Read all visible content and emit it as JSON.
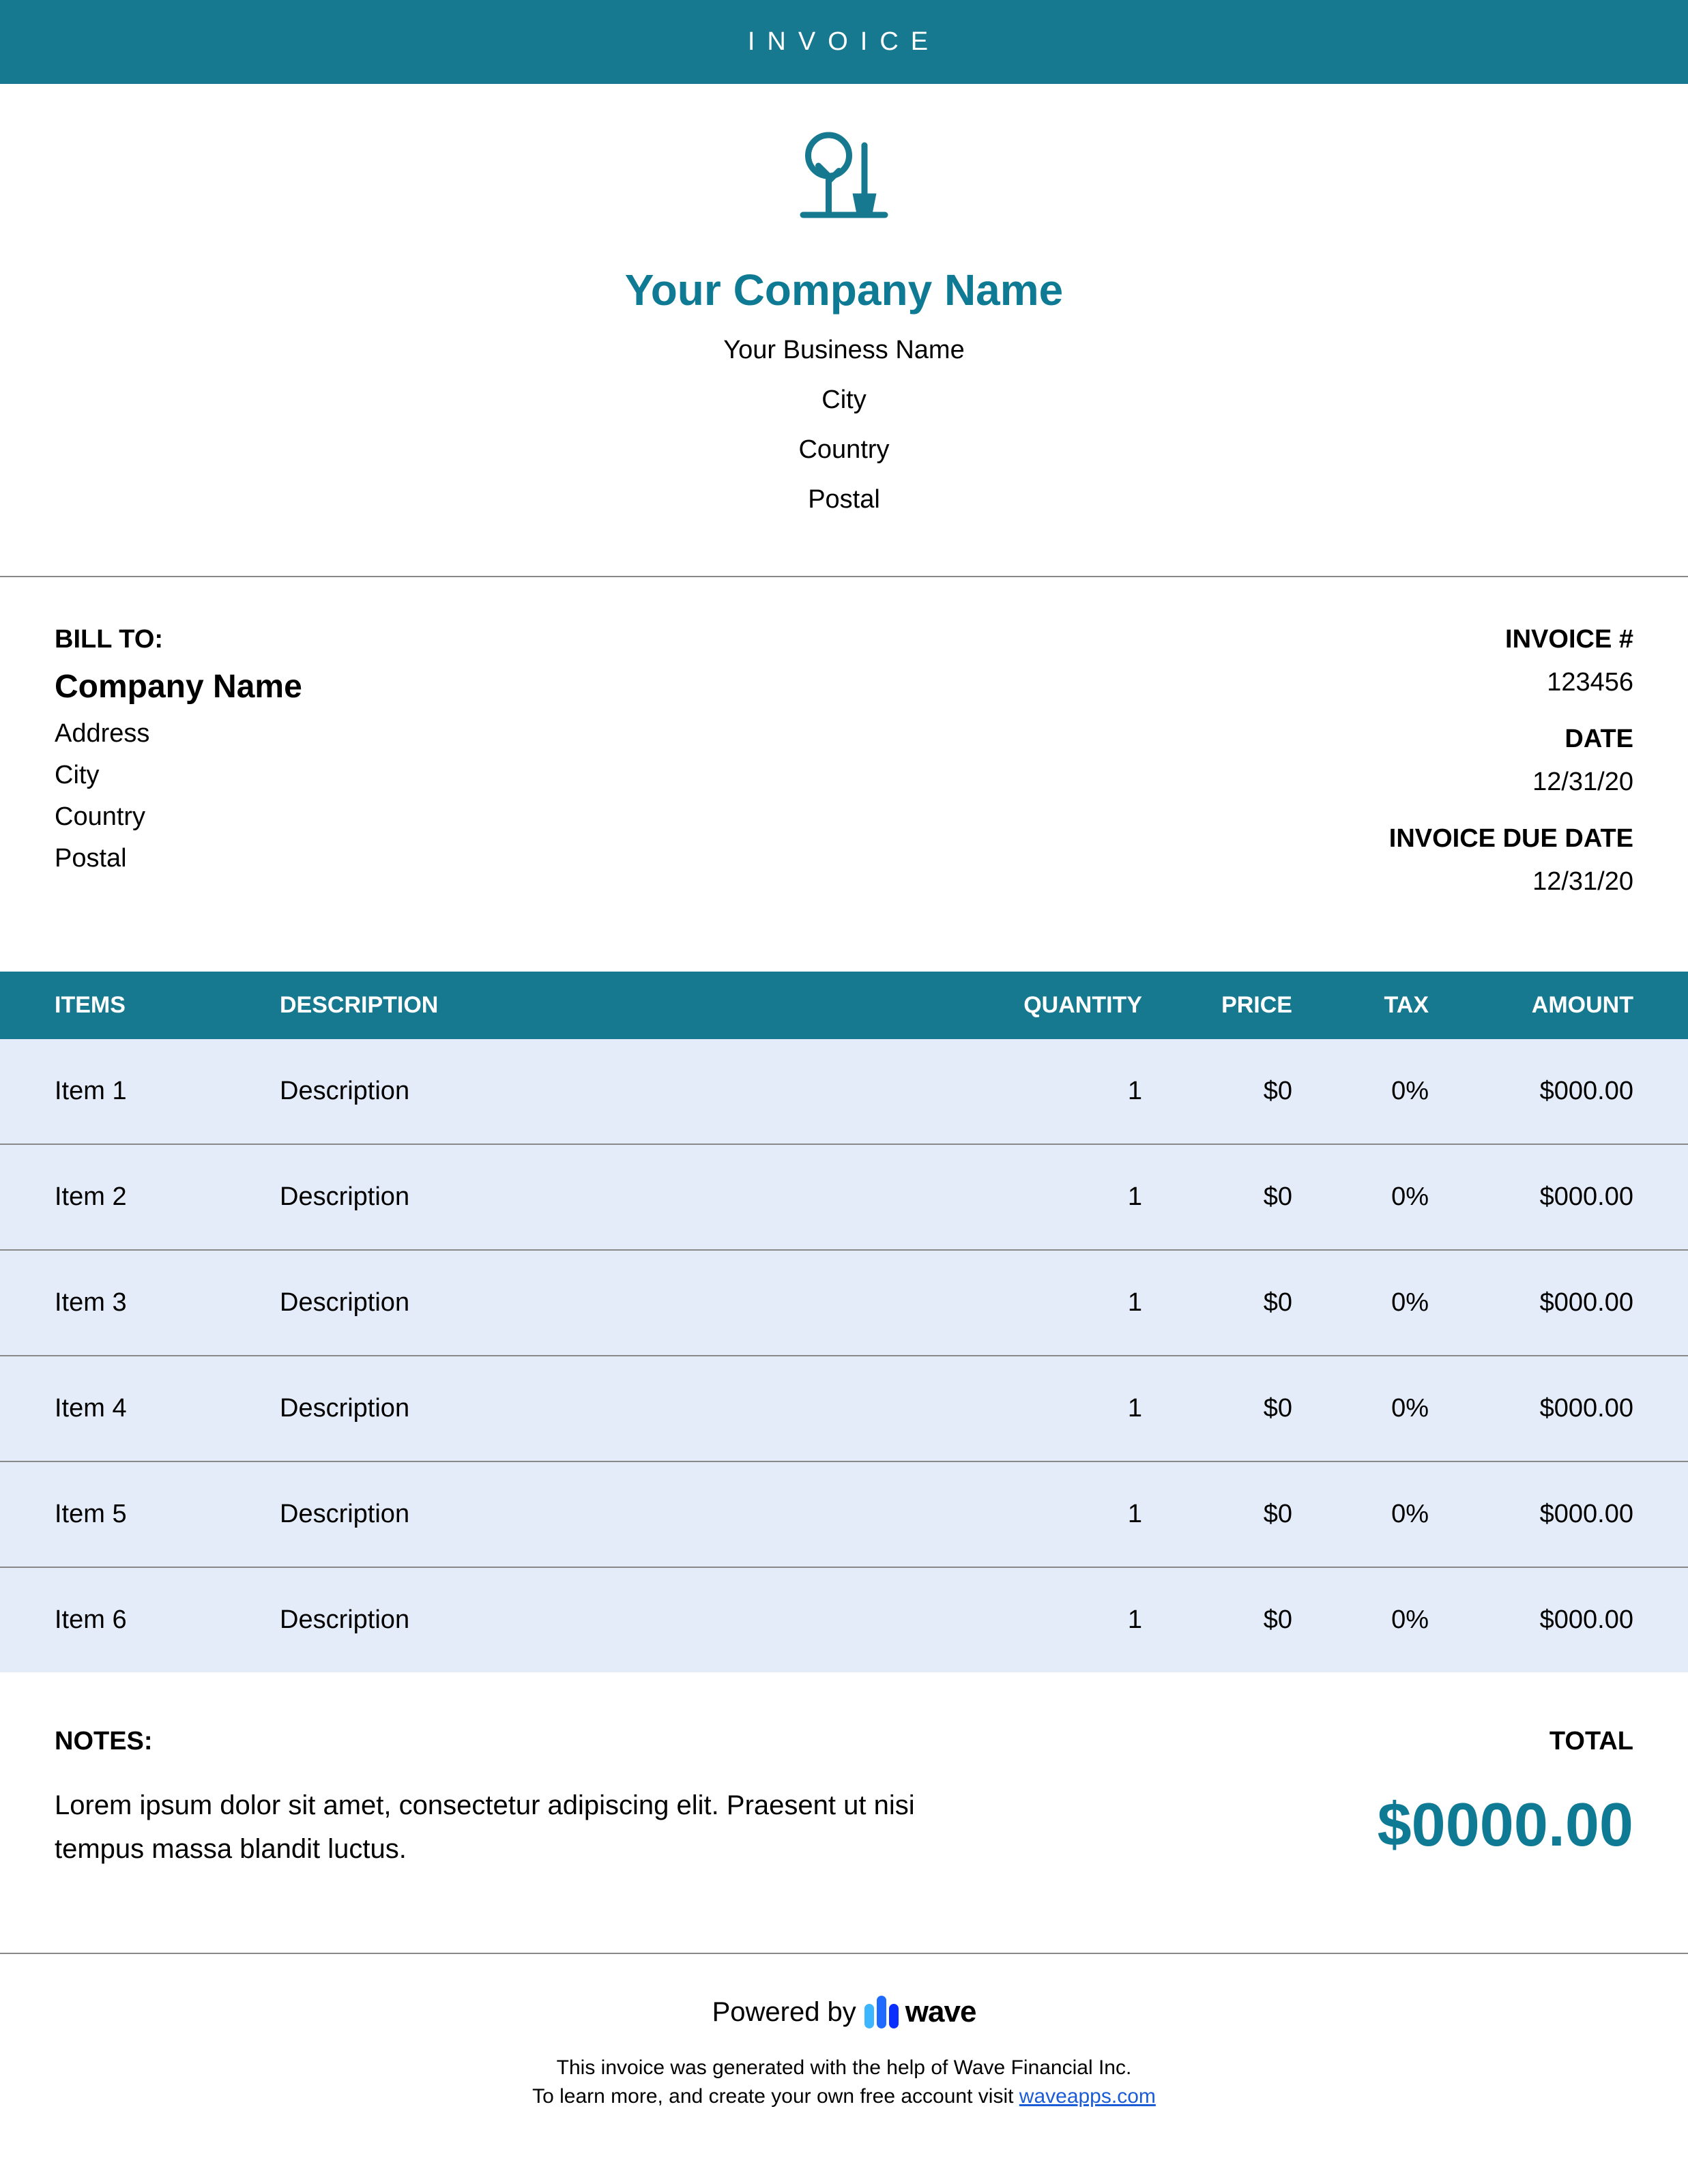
{
  "banner": "INVOICE",
  "company": {
    "name": "Your Company Name",
    "business": "Your Business Name",
    "city": "City",
    "country": "Country",
    "postal": "Postal"
  },
  "bill_to": {
    "label": "BILL TO:",
    "company": "Company Name",
    "address": "Address",
    "city": "City",
    "country": "Country",
    "postal": "Postal"
  },
  "meta": {
    "invoice_num_label": "INVOICE #",
    "invoice_num": "123456",
    "date_label": "DATE",
    "date": "12/31/20",
    "due_label": "INVOICE DUE DATE",
    "due": "12/31/20"
  },
  "columns": {
    "items": "ITEMS",
    "description": "DESCRIPTION",
    "quantity": "QUANTITY",
    "price": "PRICE",
    "tax": "TAX",
    "amount": "AMOUNT"
  },
  "rows": [
    {
      "item": "Item 1",
      "desc": "Description",
      "qty": "1",
      "price": "$0",
      "tax": "0%",
      "amount": "$000.00"
    },
    {
      "item": "Item 2",
      "desc": "Description",
      "qty": "1",
      "price": "$0",
      "tax": "0%",
      "amount": "$000.00"
    },
    {
      "item": "Item 3",
      "desc": "Description",
      "qty": "1",
      "price": "$0",
      "tax": "0%",
      "amount": "$000.00"
    },
    {
      "item": "Item 4",
      "desc": "Description",
      "qty": "1",
      "price": "$0",
      "tax": "0%",
      "amount": "$000.00"
    },
    {
      "item": "Item 5",
      "desc": "Description",
      "qty": "1",
      "price": "$0",
      "tax": "0%",
      "amount": "$000.00"
    },
    {
      "item": "Item 6",
      "desc": "Description",
      "qty": "1",
      "price": "$0",
      "tax": "0%",
      "amount": "$000.00"
    }
  ],
  "notes": {
    "label": "NOTES:",
    "text": "Lorem ipsum dolor sit amet, consectetur adipiscing elit. Praesent ut nisi tempus massa blandit luctus."
  },
  "total": {
    "label": "TOTAL",
    "amount": "$0000.00"
  },
  "footer": {
    "powered_by": "Powered by",
    "brand": "wave",
    "line1": "This invoice was generated with the help of Wave Financial Inc.",
    "line2_pre": "To learn more, and create your own free account visit ",
    "link": "waveapps.com"
  }
}
